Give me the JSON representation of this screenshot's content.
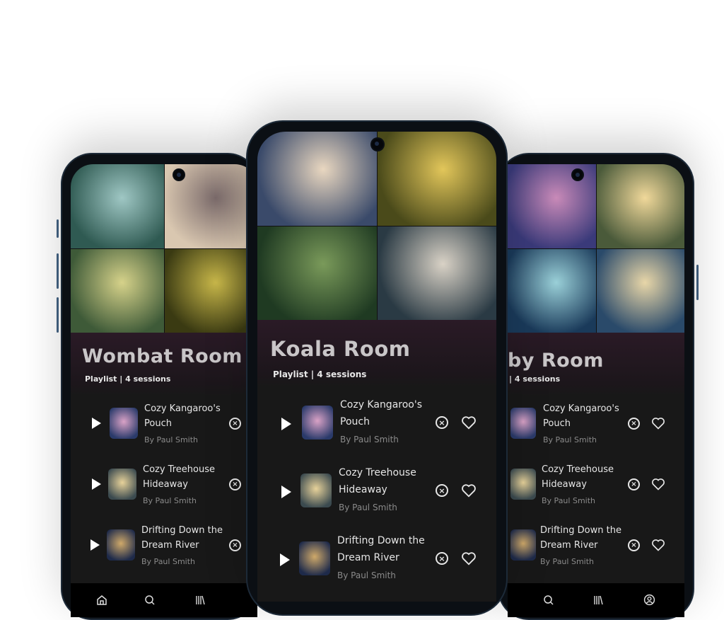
{
  "phones": [
    {
      "id": "left",
      "title": "Wombat Room",
      "subtitle": "Playlist | 4 sessions",
      "cover_colors": [
        [
          "#2f5a52",
          "#9fc7c4"
        ],
        [
          "#d9c7b0",
          "#7a6a6a"
        ],
        [
          "#3e5a38",
          "#d6d28a"
        ],
        [
          "#3a3a12",
          "#c9b84a"
        ]
      ],
      "tracks": [
        {
          "name_line1": "Cozy Kangaroo's",
          "name_line2": "Pouch",
          "artist": "By Paul Smith",
          "thumb": [
            "#2a3a6a",
            "#d9a2c6"
          ]
        },
        {
          "name_line1": "Cozy Treehouse",
          "name_line2": "Hideaway",
          "artist": "By Paul Smith",
          "thumb": [
            "#3b4a4f",
            "#e7d29a"
          ]
        },
        {
          "name_line1": "Drifting Down the",
          "name_line2": "Dream River",
          "artist": "By Paul Smith",
          "thumb": [
            "#1e2a4a",
            "#cfa96a"
          ]
        }
      ],
      "nav": [
        "home-icon",
        "search-icon",
        "library-icon"
      ]
    },
    {
      "id": "center",
      "title": "Koala Room",
      "subtitle": "Playlist | 4 sessions",
      "cover_colors": [
        [
          "#3a4a6a",
          "#e9d7c0"
        ],
        [
          "#4a4a1a",
          "#e2c65a"
        ],
        [
          "#1f3a22",
          "#7a9a5a"
        ],
        [
          "#2a3a44",
          "#d9d2c6"
        ]
      ],
      "tracks": [
        {
          "name_line1": "Cozy Kangaroo's",
          "name_line2": "Pouch",
          "artist": "By Paul Smith",
          "thumb": [
            "#2a3a6a",
            "#d9a2c6"
          ]
        },
        {
          "name_line1": "Cozy Treehouse",
          "name_line2": "Hideaway",
          "artist": "By Paul Smith",
          "thumb": [
            "#3b4a4f",
            "#e7d29a"
          ]
        },
        {
          "name_line1": "Drifting Down the",
          "name_line2": "Dream River",
          "artist": "By Paul Smith",
          "thumb": [
            "#1e2a4a",
            "#cfa96a"
          ]
        }
      ]
    },
    {
      "id": "right",
      "title": "by Room",
      "subtitle": "| 4 sessions",
      "cover_colors": [
        [
          "#3a3a7a",
          "#c98ab8"
        ],
        [
          "#4a5a3a",
          "#f0d89a"
        ],
        [
          "#1a3a5a",
          "#9ad0d8"
        ],
        [
          "#2a4a6a",
          "#e8d6a8"
        ]
      ],
      "tracks": [
        {
          "name_line1": "Cozy Kangaroo's",
          "name_line2": "Pouch",
          "artist": "By Paul Smith",
          "thumb": [
            "#2a3a6a",
            "#d9a2c6"
          ]
        },
        {
          "name_line1": "Cozy Treehouse",
          "name_line2": "Hideaway",
          "artist": "By Paul Smith",
          "thumb": [
            "#3b4a4f",
            "#e7d29a"
          ]
        },
        {
          "name_line1": "Drifting Down the",
          "name_line2": "Dream River",
          "artist": "By Paul Smith",
          "thumb": [
            "#1e2a4a",
            "#cfa96a"
          ]
        }
      ],
      "nav": [
        "search-icon",
        "library-icon",
        "profile-icon"
      ]
    }
  ],
  "icons": {
    "play": "play-icon",
    "remove": "remove-circle-icon",
    "favorite": "heart-icon",
    "remove_glyph": "×"
  }
}
